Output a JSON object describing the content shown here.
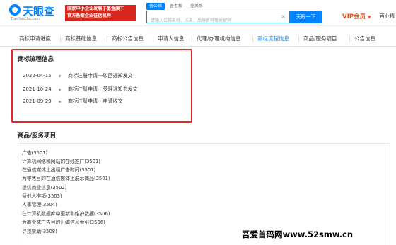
{
  "header": {
    "logo_text": "天眼查",
    "logo_sub": "TianYanCha.com",
    "promo_line1": "国家中小企业发展子基金旗下",
    "promo_line2": "官方备案企业征信机构",
    "search_tabs": [
      "查公司",
      "查老板",
      "查关系"
    ],
    "search_placeholder": "请输入公司名称、人名、品牌名称等关键词",
    "search_clear": "×",
    "search_button": "天眼一下",
    "vip_label": "VIP会员",
    "vip_caret": "▼",
    "right_text": "百业精"
  },
  "nav": {
    "tabs": [
      "商标申请进度",
      "商标基础信息",
      "商标公告信息",
      "申请人信息",
      "代理/办理机构信息",
      "商标流程信息",
      "商品/服务项目",
      "公告信息"
    ],
    "active_index": 5
  },
  "flow": {
    "title": "商标流程信息",
    "items": [
      {
        "date": "2022-04-15",
        "text": "商标注册申请---驳回通知发文"
      },
      {
        "date": "2021-10-24",
        "text": "商标注册申请---受理通知书发文"
      },
      {
        "date": "2021-09-29",
        "text": "商标注册申请---申请收文"
      }
    ]
  },
  "goods": {
    "title": "商品/服务项目",
    "items": [
      "广告(3501)",
      "计算机网络和网站的在线推广(3501)",
      "在通信媒体上出租广告时间(3501)",
      "为零售目的在通信媒体上展示商品(3501)",
      "提供商业信息(3502)",
      "替他人推销(3503)",
      "人事管理(3504)",
      "在计算机数据库中更新和维护数据(3506)",
      "为商业或广告目的汇编信息索引(3506)",
      "寻找赞助(3508)"
    ]
  },
  "watermark": "吾爱首码网www.52smw.cn",
  "colors": {
    "brand": "#0084ff",
    "promo": "#d9261c",
    "vip": "#e8541e",
    "highlight": "#e8262a"
  }
}
